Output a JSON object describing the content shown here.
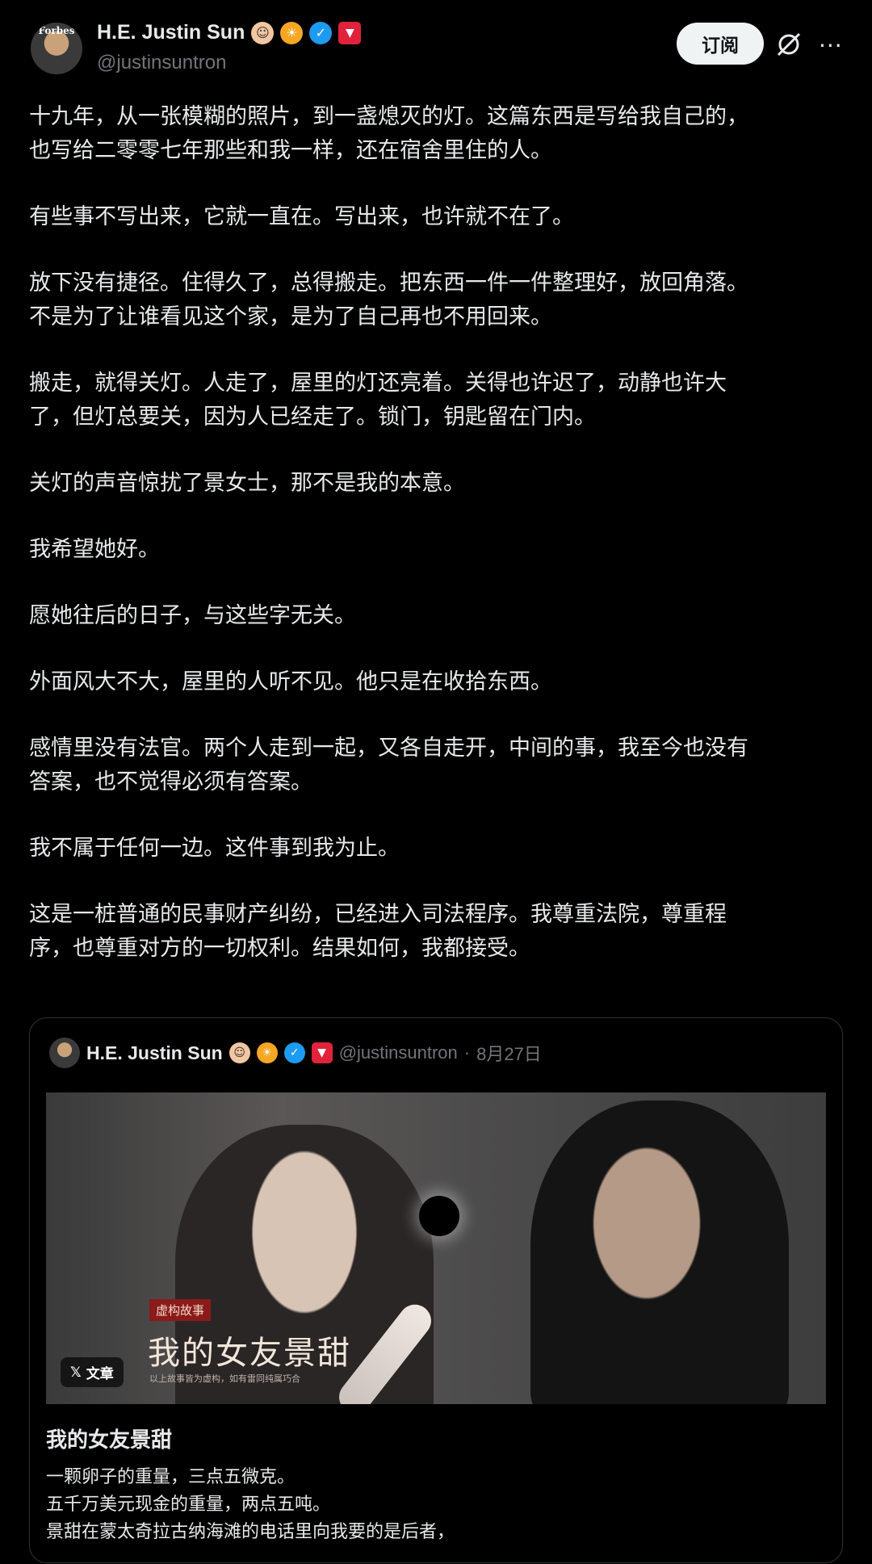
{
  "author": {
    "name": "H.E. Justin Sun",
    "handle": "@justinsuntron",
    "avatar_text": "Forbes",
    "badges": [
      "scientist-emoji",
      "sun-emoji",
      "verified-badge",
      "tron-badge"
    ]
  },
  "actions": {
    "subscribe_label": "订阅",
    "grok_icon": "grok-icon",
    "more_icon": "more-icon",
    "more_glyph": "···"
  },
  "post": {
    "paragraphs": [
      "十九年，从一张模糊的照片，到一盏熄灭的灯。这篇东西是写给我自己的，\n也写给二零零七年那些和我一样，还在宿舍里住的人。",
      "有些事不写出来，它就一直在。写出来，也许就不在了。",
      "放下没有捷径。住得久了，总得搬走。把东西一件一件整理好，放回角落。\n不是为了让谁看见这个家，是为了自己再也不用回来。",
      "搬走，就得关灯。人走了，屋里的灯还亮着。关得也许迟了，动静也许大\n了，但灯总要关，因为人已经走了。锁门，钥匙留在门内。",
      "关灯的声音惊扰了景女士，那不是我的本意。",
      "我希望她好。",
      "愿她往后的日子，与这些字无关。",
      "外面风大不大，屋里的人听不见。他只是在收拾东西。",
      "感情里没有法官。两个人走到一起，又各自走开，中间的事，我至今也没有\n答案，也不觉得必须有答案。",
      "我不属于任何一边。这件事到我为止。",
      "这是一桩普通的民事财产纠纷，已经进入司法程序。我尊重法院，尊重程\n序，也尊重对方的一切权利。结果如何，我都接受。"
    ]
  },
  "quoted": {
    "name": "H.E. Justin Sun",
    "handle": "@justinsuntron",
    "separator": "·",
    "date": "8月27日",
    "image": {
      "tag": "虚构故事",
      "title": "我的女友景甜",
      "disclaimer": "以上故事皆为虚构，如有雷同纯属巧合",
      "chip_icon": "x-logo-icon",
      "chip_label": "文章"
    },
    "article_title": "我的女友景甜",
    "lines": [
      "一颗卵子的重量，三点五微克。",
      "五千万美元现金的重量，两点五吨。",
      "景甜在蒙太奇拉古纳海滩的电话里向我要的是后者，"
    ]
  }
}
